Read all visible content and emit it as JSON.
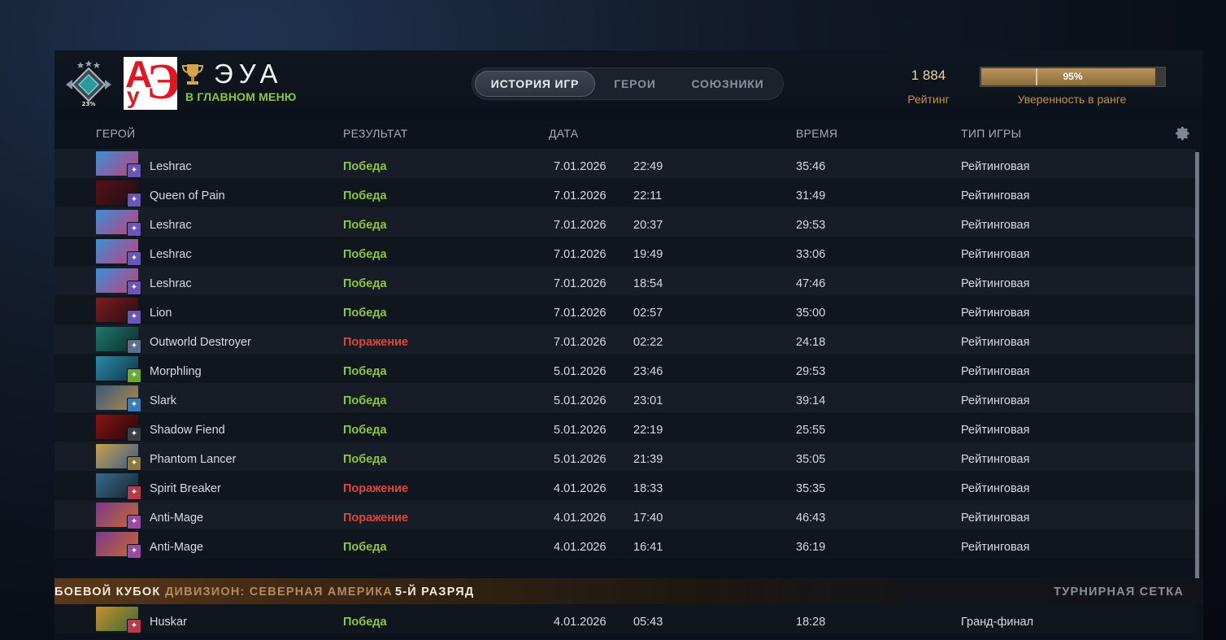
{
  "player": {
    "name": "ЭУА",
    "status": "В ГЛАВНОМ МЕНЮ",
    "rank_percent_label": "23%",
    "avatar_text": [
      "А",
      "у",
      "Э"
    ]
  },
  "tabs": [
    {
      "label": "ИСТОРИЯ ИГР",
      "active": true
    },
    {
      "label": "ГЕРОИ",
      "active": false
    },
    {
      "label": "СОЮЗНИКИ",
      "active": false
    }
  ],
  "rating": {
    "value": "1 884",
    "label": "Рейтинг"
  },
  "confidence": {
    "percent": 95,
    "text": "95%",
    "label": "Уверенность в ранге"
  },
  "columns": {
    "hero": "ГЕРОЙ",
    "result": "РЕЗУЛЬТАТ",
    "date": "ДАТА",
    "duration": "ВРЕМЯ",
    "game_type": "ТИП ИГРЫ"
  },
  "matches": [
    {
      "hero": "Leshrac",
      "result": "Победа",
      "win": true,
      "date": "7.01.2026",
      "time": "22:49",
      "duration": "35:46",
      "type": "Рейтинговая",
      "colors": [
        "#3a8fd6",
        "#c2407a"
      ],
      "badge": "#6b56b8"
    },
    {
      "hero": "Queen of Pain",
      "result": "Победа",
      "win": true,
      "date": "7.01.2026",
      "time": "22:11",
      "duration": "31:49",
      "type": "Рейтинговая",
      "colors": [
        "#5a1018",
        "#1a1014"
      ],
      "badge": "#6b56b8"
    },
    {
      "hero": "Leshrac",
      "result": "Победа",
      "win": true,
      "date": "7.01.2026",
      "time": "20:37",
      "duration": "29:53",
      "type": "Рейтинговая",
      "colors": [
        "#3a8fd6",
        "#c2407a"
      ],
      "badge": "#6b56b8"
    },
    {
      "hero": "Leshrac",
      "result": "Победа",
      "win": true,
      "date": "7.01.2026",
      "time": "19:49",
      "duration": "33:06",
      "type": "Рейтинговая",
      "colors": [
        "#3a8fd6",
        "#c2407a"
      ],
      "badge": "#6b56b8"
    },
    {
      "hero": "Leshrac",
      "result": "Победа",
      "win": true,
      "date": "7.01.2026",
      "time": "18:54",
      "duration": "47:46",
      "type": "Рейтинговая",
      "colors": [
        "#3a8fd6",
        "#c2407a"
      ],
      "badge": "#6b56b8"
    },
    {
      "hero": "Lion",
      "result": "Победа",
      "win": true,
      "date": "7.01.2026",
      "time": "02:57",
      "duration": "35:00",
      "type": "Рейтинговая",
      "colors": [
        "#7a1e22",
        "#2a0c10"
      ],
      "badge": "#6b56b8"
    },
    {
      "hero": "Outworld Destroyer",
      "result": "Поражение",
      "win": false,
      "date": "7.01.2026",
      "time": "02:22",
      "duration": "24:18",
      "type": "Рейтинговая",
      "colors": [
        "#1f7a6a",
        "#0d2a2a"
      ],
      "badge": "#5a6f8c"
    },
    {
      "hero": "Morphling",
      "result": "Победа",
      "win": true,
      "date": "5.01.2026",
      "time": "23:46",
      "duration": "29:53",
      "type": "Рейтинговая",
      "colors": [
        "#2a8aa6",
        "#0f3446"
      ],
      "badge": "#6aa830"
    },
    {
      "hero": "Slark",
      "result": "Победа",
      "win": true,
      "date": "5.01.2026",
      "time": "23:01",
      "duration": "39:14",
      "type": "Рейтинговая",
      "colors": [
        "#3a5a7a",
        "#b08a4a"
      ],
      "badge": "#3a7ab8"
    },
    {
      "hero": "Shadow Fiend",
      "result": "Победа",
      "win": true,
      "date": "5.01.2026",
      "time": "22:19",
      "duration": "25:55",
      "type": "Рейтинговая",
      "colors": [
        "#8a1414",
        "#220808"
      ],
      "badge": "#3a3f46"
    },
    {
      "hero": "Phantom Lancer",
      "result": "Победа",
      "win": true,
      "date": "5.01.2026",
      "time": "21:39",
      "duration": "35:05",
      "type": "Рейтинговая",
      "colors": [
        "#c8a24a",
        "#3a5a8a"
      ],
      "badge": "#8a7a3a"
    },
    {
      "hero": "Spirit Breaker",
      "result": "Поражение",
      "win": false,
      "date": "4.01.2026",
      "time": "18:33",
      "duration": "35:35",
      "type": "Рейтинговая",
      "colors": [
        "#3a6a8a",
        "#142430"
      ],
      "badge": "#b83a4a"
    },
    {
      "hero": "Anti-Mage",
      "result": "Поражение",
      "win": false,
      "date": "4.01.2026",
      "time": "17:40",
      "duration": "46:43",
      "type": "Рейтинговая",
      "colors": [
        "#7a3a8a",
        "#c86a30"
      ],
      "badge": "#9a4aa6"
    },
    {
      "hero": "Anti-Mage",
      "result": "Победа",
      "win": true,
      "date": "4.01.2026",
      "time": "16:41",
      "duration": "36:19",
      "type": "Рейтинговая",
      "colors": [
        "#7a3a8a",
        "#c86a30"
      ],
      "badge": "#9a4aa6"
    }
  ],
  "event": {
    "title": "БОЕВОЙ КУБОК",
    "division": "ДИВИЗИОН: СЕВЕРНАЯ АМЕРИКА",
    "tier": "5-Й РАЗРЯД",
    "link": "ТУРНИРНАЯ СЕТКА"
  },
  "event_matches": [
    {
      "hero": "Huskar",
      "result": "Победа",
      "win": true,
      "date": "4.01.2026",
      "time": "05:43",
      "duration": "18:28",
      "type": "Гранд-финал",
      "colors": [
        "#c8902a",
        "#3a6a3a"
      ],
      "badge": "#b83a4a"
    }
  ],
  "icons": {
    "medal": "rank-medal-icon",
    "trophy": "trophy-icon",
    "settings": "gear-icon"
  },
  "colors": {
    "win": "#8ec63f",
    "loss": "#e0463a",
    "gold": "#c1914f",
    "status": "#8ec63f"
  }
}
